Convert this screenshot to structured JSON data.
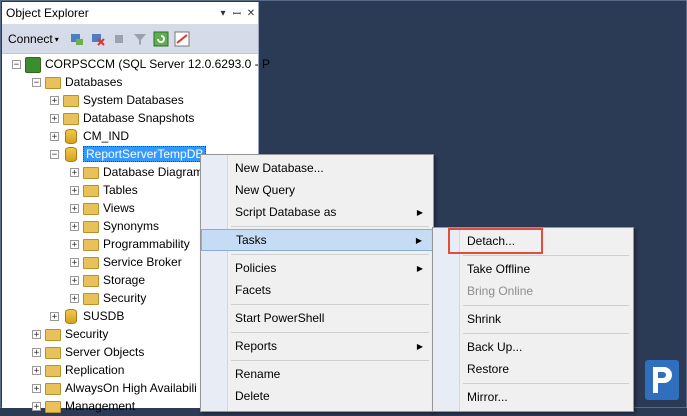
{
  "panel": {
    "title": "Object Explorer",
    "pin_glyph": "▾ ⊥ ✕",
    "connect_label": "Connect"
  },
  "tree": {
    "server": "CORPSCCM (SQL Server 12.0.6293.0 - P",
    "databases": "Databases",
    "system_databases": "System Databases",
    "database_snapshots": "Database Snapshots",
    "cm_ind": "CM_IND",
    "reportservertempdb": "ReportServerTempDB",
    "children": [
      "Database Diagrams",
      "Tables",
      "Views",
      "Synonyms",
      "Programmability",
      "Service Broker",
      "Storage",
      "Security"
    ],
    "susdb": "SUSDB",
    "security": "Security",
    "server_objects": "Server Objects",
    "replication": "Replication",
    "alwayson": "AlwaysOn High Availabili",
    "management": "Management"
  },
  "context_menu": {
    "new_database": "New Database...",
    "new_query": "New Query",
    "script_database_as": "Script Database as",
    "tasks": "Tasks",
    "policies": "Policies",
    "facets": "Facets",
    "start_powershell": "Start PowerShell",
    "reports": "Reports",
    "rename": "Rename",
    "delete": "Delete"
  },
  "tasks_menu": {
    "detach": "Detach...",
    "take_offline": "Take Offline",
    "bring_online": "Bring Online",
    "shrink": "Shrink",
    "back_up": "Back Up...",
    "restore": "Restore",
    "mirror": "Mirror..."
  },
  "colors": {
    "highlight_box": "#e24c3c",
    "selection": "#3399ff"
  }
}
